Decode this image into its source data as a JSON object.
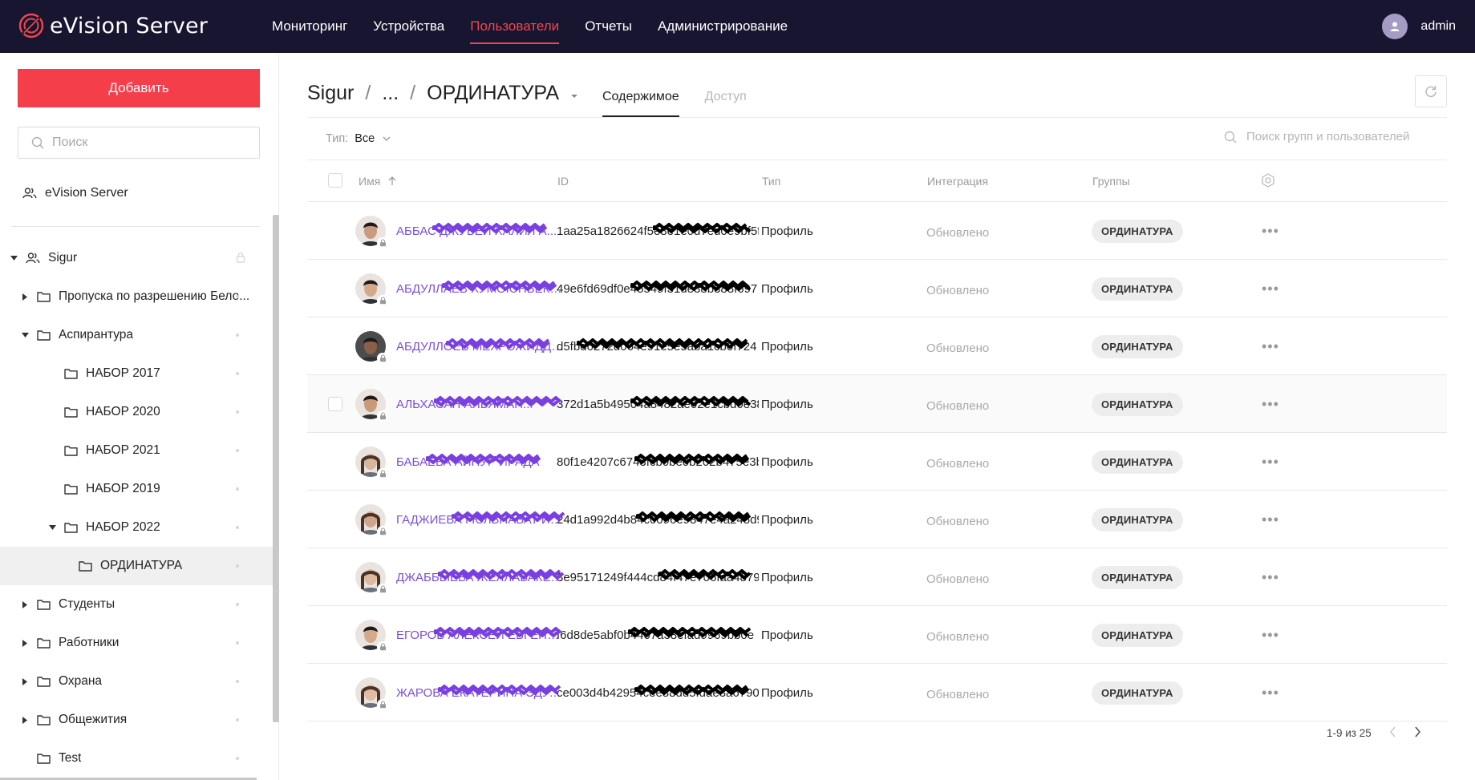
{
  "app": {
    "brand": "eVision Server"
  },
  "nav": [
    {
      "label": "Мониторинг",
      "active": false
    },
    {
      "label": "Устройства",
      "active": false
    },
    {
      "label": "Пользователи",
      "active": true
    },
    {
      "label": "Отчеты",
      "active": false
    },
    {
      "label": "Администрирование",
      "active": false
    }
  ],
  "user": {
    "name": "admin"
  },
  "sidebar": {
    "add_label": "Добавить",
    "search_placeholder": "Поиск",
    "root_label": "eVision Server",
    "tree": [
      {
        "label": "Sigur",
        "level": 0,
        "caret": "down",
        "icon": "users-icon",
        "marker": "lock"
      },
      {
        "label": "Пропуска по разрешению Бело...",
        "level": 1,
        "caret": "right",
        "icon": "folder-icon"
      },
      {
        "label": "Аспирантура",
        "level": 1,
        "caret": "down",
        "icon": "folder-icon"
      },
      {
        "label": "НАБОР 2017",
        "level": 2,
        "caret": "none",
        "icon": "folder-icon"
      },
      {
        "label": "НАБОР 2020",
        "level": 2,
        "caret": "none",
        "icon": "folder-icon"
      },
      {
        "label": "НАБОР 2021",
        "level": 2,
        "caret": "none",
        "icon": "folder-icon"
      },
      {
        "label": "НАБОР 2019",
        "level": 2,
        "caret": "none",
        "icon": "folder-icon"
      },
      {
        "label": "НАБОР 2022",
        "level": 2,
        "caret": "down",
        "icon": "folder-icon"
      },
      {
        "label": "ОРДИНАТУРА",
        "level": 3,
        "caret": "none",
        "icon": "folder-icon",
        "selected": true
      },
      {
        "label": "Студенты",
        "level": 1,
        "caret": "right",
        "icon": "folder-icon"
      },
      {
        "label": "Работники",
        "level": 1,
        "caret": "right",
        "icon": "folder-icon"
      },
      {
        "label": "Охрана",
        "level": 1,
        "caret": "right",
        "icon": "folder-icon"
      },
      {
        "label": "Общежития",
        "level": 1,
        "caret": "right",
        "icon": "folder-icon"
      },
      {
        "label": "Test",
        "level": 1,
        "caret": "none",
        "icon": "folder-icon"
      }
    ]
  },
  "main": {
    "breadcrumb": {
      "root": "Sigur",
      "ellipsis": "...",
      "current": "ОРДИНАТУРА"
    },
    "tabs": [
      {
        "label": "Содержимое",
        "active": true
      },
      {
        "label": "Доступ",
        "active": false
      }
    ],
    "filter": {
      "label": "Тип:",
      "value": "Все"
    },
    "search_placeholder": "Поиск групп и пользователей",
    "columns": {
      "name": "Имя",
      "id": "ID",
      "type": "Тип",
      "integration": "Интеграция",
      "groups": "Группы"
    },
    "rows": [
      {
        "name": "АББАС ДЖУБЕЙ ХАЛИЛ А...",
        "id": "1aa25a1826624f5e8e1e0d7ed0e9bf5f0",
        "type": "Профиль",
        "integration": "Обновлено",
        "group": "ОРДИНАТУРА",
        "avatar": "male"
      },
      {
        "name": "АБДУЛЛАЕВ ХУМОЮНБЕК РАХ...",
        "id": "49e6fd69df0e45549f31de38b388f697",
        "type": "Профиль",
        "integration": "Обновлено",
        "group": "ОРДИНАТУРА",
        "avatar": "male"
      },
      {
        "name": "АБДУЛЛОЕВ МЕХРОЖИДДИН...",
        "id": "d5fbd6272d064e91e5e5aba1cb0f724",
        "type": "Профиль",
        "integration": "Обновлено",
        "group": "ОРДИНАТУРА",
        "avatar": "male-dark"
      },
      {
        "name": "АЛЬХАСАН АЛЬЯМАН...",
        "id": "372d1a5b49504a8482ae02e1cbd0e38e",
        "type": "Профиль",
        "integration": "Обновлено",
        "group": "ОРДИНАТУРА",
        "avatar": "male"
      },
      {
        "name": "БАБАЕВА АЙНУР ИРАДА",
        "id": "80f1e4207c6743fcb0be0b202b475e3b",
        "type": "Профиль",
        "integration": "Обновлено",
        "group": "ОРДИНАТУРА",
        "avatar": "female"
      },
      {
        "name": "ГАДЖИЕВА ГЮЛЬНАБАТ ИЛ...",
        "id": "24d1a992d4b84c0096e9847e4a245d94",
        "type": "Профиль",
        "integration": "Обновлено",
        "group": "ОРДИНАТУРА",
        "avatar": "female"
      },
      {
        "name": "ДЖАББЫЕВА ЖЕЛЛАБАКЕРН...",
        "id": "3e95171249f444cd84f47e706faa48790",
        "type": "Профиль",
        "integration": "Обновлено",
        "group": "ОРДИНАТУРА",
        "avatar": "female"
      },
      {
        "name": "ЕГОРОВ АЛЕКСЕЙ ЕВГЕНЬЕВ...",
        "id": "f6d8de5abf0b4407a38efad9969bb0e",
        "type": "Профиль",
        "integration": "Обновлено",
        "group": "ОРДИНАТУРА",
        "avatar": "male"
      },
      {
        "name": "ЖАРОВА ЕКАТЕРИНА ЭДУА...",
        "id": "ce003d4b42954cee88dd5fdae3a6790",
        "type": "Профиль",
        "integration": "Обновлено",
        "group": "ОРДИНАТУРА",
        "avatar": "female"
      }
    ],
    "pagination": "1-9 из 25"
  },
  "colors": {
    "topbar": "#17152f",
    "accent": "#f43f4b",
    "link": "#7a4fd8"
  }
}
